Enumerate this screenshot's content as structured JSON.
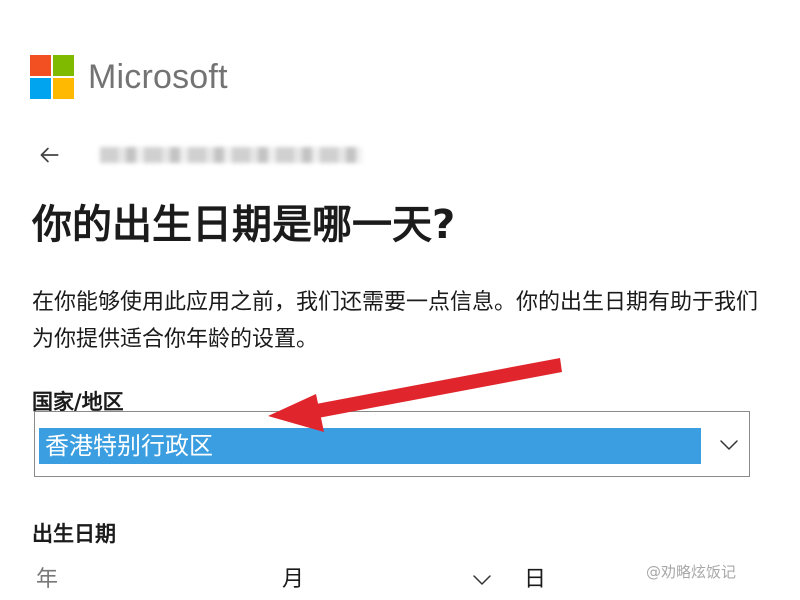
{
  "brand": {
    "name": "Microsoft",
    "tile_colors": [
      "#f25022",
      "#7fba00",
      "#00a4ef",
      "#ffb900"
    ]
  },
  "header": {
    "back_icon": "arrow-left-icon"
  },
  "page": {
    "title": "你的出生日期是哪一天?",
    "description": "在你能够使用此应用之前，我们还需要一点信息。你的出生日期有助于我们为你提供适合你年龄的设置。"
  },
  "region": {
    "label": "国家/地区",
    "value": "香港特别行政区",
    "chevron_icon": "chevron-down-icon",
    "highlight_color": "#3b9ee0"
  },
  "birthdate": {
    "label": "出生日期",
    "year_placeholder": "年",
    "month_placeholder": "月",
    "day_placeholder": "日"
  },
  "annotation": {
    "arrow_color": "#e0262c",
    "arrow_icon": "red-arrow-icon"
  },
  "watermark": {
    "text": "@劝略炫饭记"
  }
}
